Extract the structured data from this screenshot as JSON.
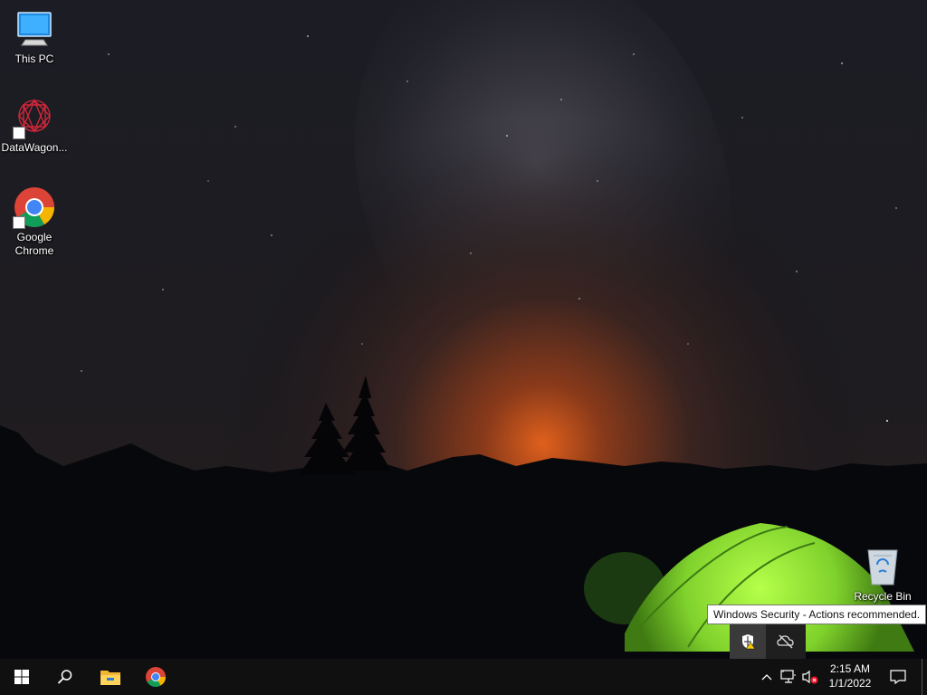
{
  "desktop": {
    "icons": [
      {
        "label": "This PC",
        "icon": "this-pc-icon"
      },
      {
        "label": "DataWagon...",
        "icon": "datawagon-icon"
      },
      {
        "label": "Google Chrome",
        "icon": "chrome-icon"
      },
      {
        "label": "Recycle Bin",
        "icon": "recycle-bin-icon"
      }
    ]
  },
  "tooltip": {
    "text": "Windows Security - Actions recommended."
  },
  "tray_popup": {
    "icons": [
      "windows-security-warning-icon",
      "onedrive-offline-icon"
    ]
  },
  "taskbar": {
    "pinned": [
      "start-icon",
      "search-icon",
      "file-explorer-icon",
      "chrome-icon"
    ],
    "tray": [
      "chevron-up-icon",
      "network-icon",
      "volume-muted-icon"
    ],
    "clock": {
      "time": "2:15 AM",
      "date": "1/1/2022"
    },
    "notification_icon": "action-center-icon"
  },
  "colors": {
    "taskbar": "#101010",
    "tent": "#8fe03a",
    "horizon_glow": "#e0601c"
  }
}
